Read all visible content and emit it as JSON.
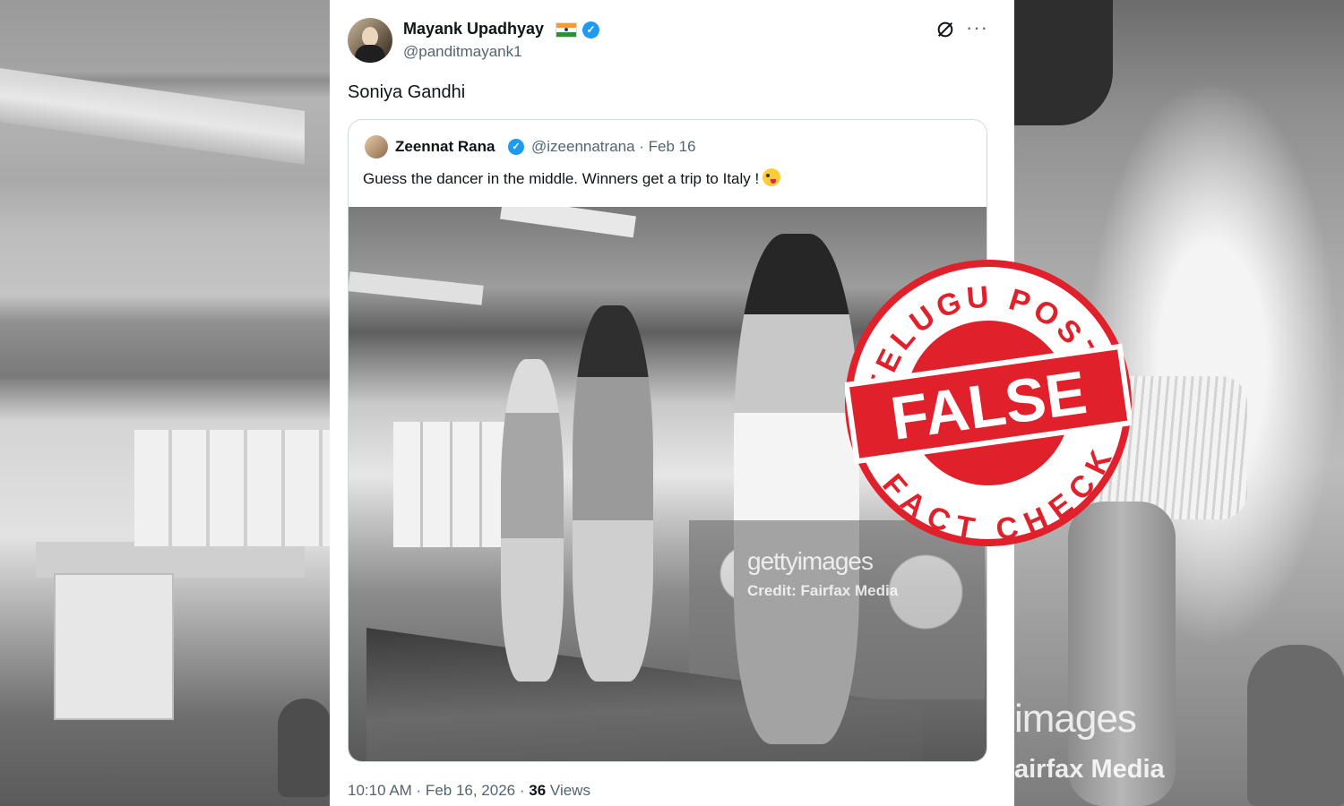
{
  "tweet": {
    "author_name": "Mayank Upadhyay",
    "author_handle": "@panditmayank1",
    "text": "Soniya Gandhi",
    "timestamp": "10:10 AM · Feb 16, 2026 ·",
    "views_count": "36",
    "views_label": "Views"
  },
  "quoted_tweet": {
    "author_name": "Zeennat Rana",
    "handle_date": "@izeennatrana · Feb 16",
    "text": "Guess the dancer in the middle. Winners get a trip to Italy !",
    "image_watermark": "gettyimages",
    "image_credit": "Credit: Fairfax Media"
  },
  "background_watermark": {
    "line1": "images",
    "line2": "airfax Media"
  },
  "stamp": {
    "top_text": "TELUGU POST",
    "main_text": "FALSE",
    "bottom_text": "FACT CHECK",
    "color": "#e0202a"
  },
  "icons": {
    "verified": "verified-badge-icon",
    "flag": "india-flag-icon",
    "grok": "grok-icon",
    "more": "more-icon",
    "emoji": "zany-face-emoji"
  }
}
